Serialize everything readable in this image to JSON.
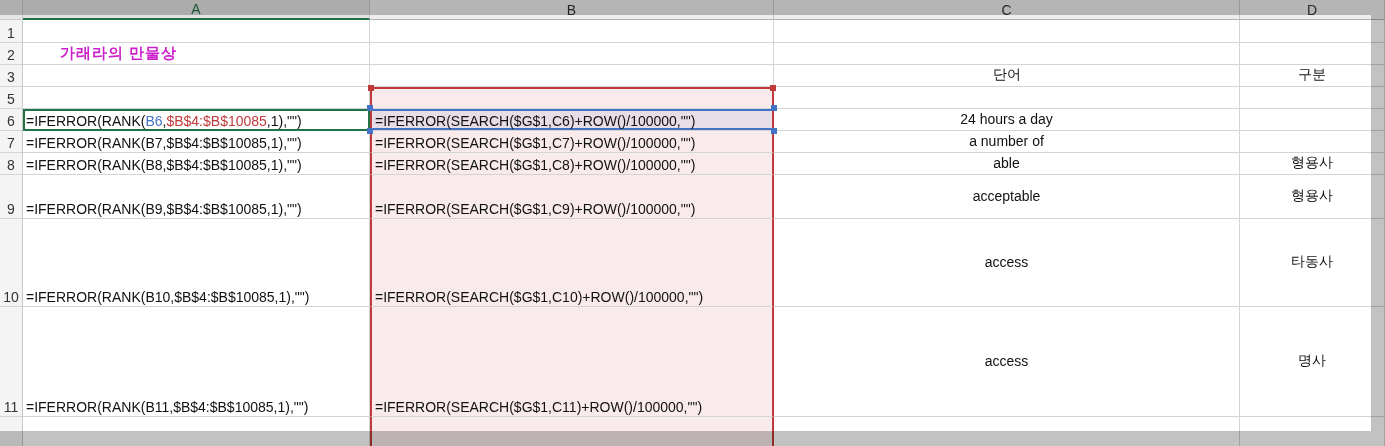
{
  "columns": [
    {
      "label": "A",
      "selected": true
    },
    {
      "label": "B",
      "selected": false
    },
    {
      "label": "C",
      "selected": false
    },
    {
      "label": "D",
      "selected": false
    }
  ],
  "rows": [
    {
      "number": "1",
      "cells": [
        {},
        {
          "in_range": false,
          "referenced": false
        },
        {},
        {}
      ]
    },
    {
      "number": "2",
      "cells": [
        {
          "kind": "title",
          "text": "가래라의 만물상"
        },
        {
          "in_range": false,
          "referenced": false
        },
        {},
        {}
      ]
    },
    {
      "number": "3",
      "cells": [
        {},
        {
          "in_range": false,
          "referenced": false
        },
        {
          "kind": "word",
          "text": "단어"
        },
        {
          "kind": "word",
          "text": "구분"
        }
      ]
    },
    {
      "number": "5",
      "cells": [
        {},
        {
          "in_range": true,
          "referenced": false
        },
        {},
        {}
      ]
    },
    {
      "number": "6",
      "cells": [
        {
          "kind": "formula",
          "active": true,
          "segments": [
            {
              "text": "=IFERROR(RANK("
            },
            {
              "text": "B6",
              "color": "#4472c4"
            },
            {
              "text": ","
            },
            {
              "text": "$B$4:$B$10085",
              "color": "#c0393b"
            },
            {
              "text": ",1),\"\")"
            }
          ]
        },
        {
          "kind": "formula",
          "text": "=IFERROR(SEARCH($G$1,C6)+ROW()/100000,\"\")",
          "in_range": true,
          "referenced": true
        },
        {
          "kind": "word",
          "text": "24 hours a day"
        },
        {}
      ]
    },
    {
      "number": "7",
      "cells": [
        {
          "kind": "formula",
          "text": "=IFERROR(RANK(B7,$B$4:$B$10085,1),\"\")"
        },
        {
          "kind": "formula",
          "text": "=IFERROR(SEARCH($G$1,C7)+ROW()/100000,\"\")",
          "in_range": true,
          "referenced": false
        },
        {
          "kind": "word",
          "text": "a number of"
        },
        {}
      ]
    },
    {
      "number": "8",
      "cells": [
        {
          "kind": "formula",
          "text": "=IFERROR(RANK(B8,$B$4:$B$10085,1),\"\")"
        },
        {
          "kind": "formula",
          "text": "=IFERROR(SEARCH($G$1,C8)+ROW()/100000,\"\")",
          "in_range": true,
          "referenced": false
        },
        {
          "kind": "word",
          "text": "able"
        },
        {
          "kind": "word",
          "text": "형용사"
        }
      ]
    },
    {
      "number": "9",
      "cells": [
        {
          "kind": "formula",
          "text": "=IFERROR(RANK(B9,$B$4:$B$10085,1),\"\")"
        },
        {
          "kind": "formula",
          "text": "=IFERROR(SEARCH($G$1,C9)+ROW()/100000,\"\")",
          "in_range": true,
          "referenced": false
        },
        {
          "kind": "word",
          "text": "acceptable"
        },
        {
          "kind": "word",
          "text": "형용사"
        }
      ]
    },
    {
      "number": "10",
      "cells": [
        {
          "kind": "formula",
          "text": "=IFERROR(RANK(B10,$B$4:$B$10085,1),\"\")"
        },
        {
          "kind": "formula",
          "text": "=IFERROR(SEARCH($G$1,C10)+ROW()/100000,\"\")",
          "in_range": true,
          "referenced": false
        },
        {
          "kind": "word",
          "text": "access"
        },
        {
          "kind": "word",
          "text": "타동사"
        }
      ]
    },
    {
      "number": "11",
      "cells": [
        {
          "kind": "formula",
          "text": "=IFERROR(RANK(B11,$B$4:$B$10085,1),\"\")"
        },
        {
          "kind": "formula",
          "text": "=IFERROR(SEARCH($G$1,C11)+ROW()/100000,\"\")",
          "in_range": true,
          "referenced": false
        },
        {
          "kind": "word",
          "text": "access"
        },
        {
          "kind": "word",
          "text": "명사"
        }
      ]
    },
    {
      "cells": [
        {},
        {
          "in_range": true,
          "referenced": false
        },
        {},
        {}
      ]
    }
  ]
}
